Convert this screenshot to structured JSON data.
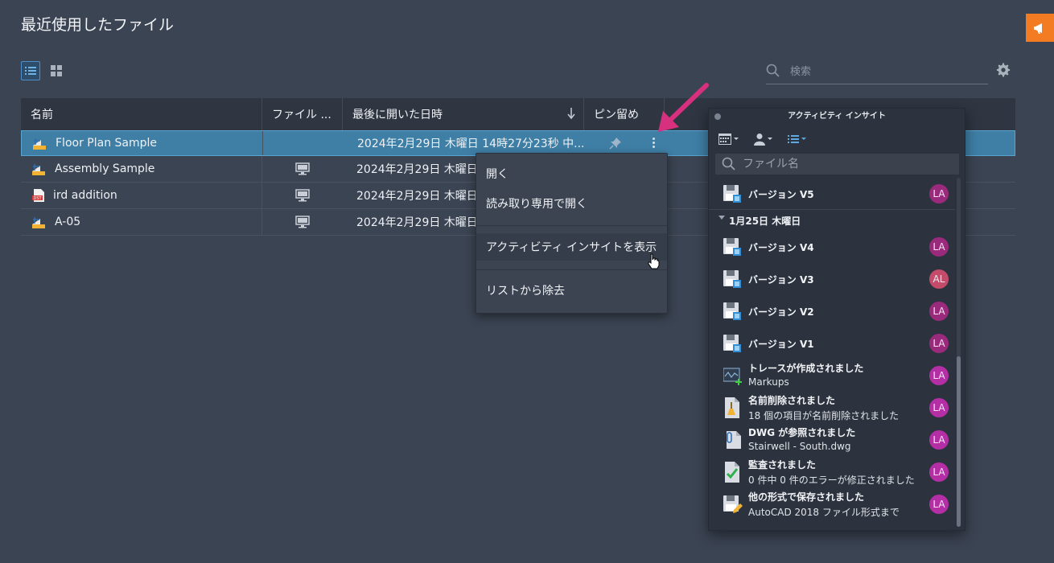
{
  "page": {
    "title": "最近使用したファイル"
  },
  "toolbar": {
    "search_placeholder": "検索"
  },
  "table": {
    "columns": [
      "名前",
      "ファイル ...",
      "最後に開いた日時",
      "ピン留め"
    ],
    "rows": [
      {
        "name": "Floor Plan Sample",
        "icon": "dwg-file-icon",
        "location": "",
        "opened": "2024年2月29日 木曜日 14時27分23秒 中...",
        "selected": true
      },
      {
        "name": "Assembly Sample",
        "icon": "dwg-file-icon",
        "location": "computer-icon",
        "opened": "2024年2月29日 木曜日 1",
        "selected": false
      },
      {
        "name": "ird addition",
        "icon": "dst-file-icon",
        "location": "computer-icon",
        "opened": "2024年2月29日 木曜日 1",
        "selected": false
      },
      {
        "name": "A-05",
        "icon": "dwg-file-icon",
        "location": "computer-icon",
        "opened": "2024年2月29日 木曜日 1",
        "selected": false
      }
    ]
  },
  "context_menu": {
    "items": [
      "開く",
      "読み取り専用で開く",
      "アクティビティ インサイトを表示",
      "リストから除去"
    ],
    "hovered_index": 2
  },
  "panel": {
    "title": "アクティビティ インサイト",
    "search_placeholder": "ファイル名",
    "first": {
      "title": "バージョン V5",
      "avatar": "LA"
    },
    "group_label": "1月25日 木曜日",
    "items": [
      {
        "title": "バージョン V4",
        "subtitle": "",
        "avatar": "LA",
        "icon": "save-version-icon"
      },
      {
        "title": "バージョン V3",
        "subtitle": "",
        "avatar": "AL",
        "icon": "save-version-icon"
      },
      {
        "title": "バージョン V2",
        "subtitle": "",
        "avatar": "LA",
        "icon": "save-version-icon"
      },
      {
        "title": "バージョン V1",
        "subtitle": "",
        "avatar": "LA",
        "icon": "save-version-icon"
      },
      {
        "title": "トレースが作成されました",
        "subtitle": "Markups",
        "avatar": "LA",
        "icon": "trace-icon"
      },
      {
        "title": "名前削除されました",
        "subtitle": "18 個の項目が名前削除されました",
        "avatar": "LA",
        "icon": "purge-icon"
      },
      {
        "title": "DWG が参照されました",
        "subtitle": "Stairwell - South.dwg",
        "avatar": "LA",
        "icon": "xref-icon"
      },
      {
        "title": "監査されました",
        "subtitle": "0 件中 0 件のエラーが修正されました",
        "avatar": "LA",
        "icon": "audit-icon"
      },
      {
        "title": "他の形式で保存されました",
        "subtitle": "AutoCAD 2018 ファイル形式まで",
        "avatar": "LA",
        "icon": "save-as-icon"
      }
    ]
  },
  "colors": {
    "background": "#3b4453",
    "selection": "#3f7fa6",
    "accent_orange": "#f37b21",
    "arrow": "#d6307f",
    "avatar_la": "#9a2a7c",
    "avatar_la_bright": "#b42fa6",
    "avatar_al": "#c44c6a"
  }
}
